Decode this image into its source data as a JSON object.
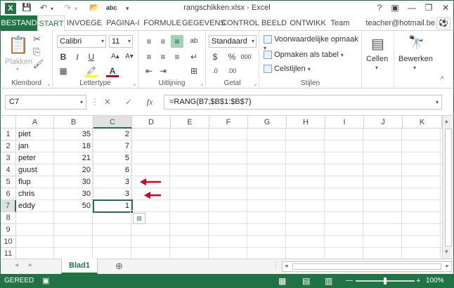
{
  "window": {
    "title": "rangschikken.xlsx - Excel",
    "help": "?",
    "ribbon_display": "▣",
    "minimize": "—",
    "restore": "❐",
    "close": "✕"
  },
  "quick_access": {
    "excel_logo": "X",
    "save": "💾",
    "undo": "↶",
    "undo_dd": "▾",
    "redo": "↷",
    "redo_dd": "▾",
    "new_file": "📂",
    "spelling": "abc",
    "customize": "▾"
  },
  "tabs": [
    {
      "label": "BESTAND"
    },
    {
      "label": "START"
    },
    {
      "label": "INVOEGE"
    },
    {
      "label": "PAGINA-I"
    },
    {
      "label": "FORMULE"
    },
    {
      "label": "GEGEVENS"
    },
    {
      "label": "CONTROL"
    },
    {
      "label": "BEELD"
    },
    {
      "label": "ONTWIKK"
    },
    {
      "label": "Team"
    }
  ],
  "user": {
    "email": "teacher@hotmail.be",
    "avatar": "⚽"
  },
  "ribbon": {
    "clipboard": {
      "label": "Klembord",
      "paste": "Plakken",
      "paste_dd": "▾",
      "paste_icon": "📋",
      "cut": "✂",
      "copy": "⎘",
      "format_painter": "🖌",
      "launcher": "⌟"
    },
    "font": {
      "label": "Lettertype",
      "name": "Calibri",
      "size": "11",
      "dd": "▾",
      "grow": "A▴",
      "shrink": "A▾",
      "bold": "B",
      "italic": "I",
      "underline": "U",
      "borders": "▦",
      "fill": "🖍",
      "font_color": "A",
      "launcher": "⌟"
    },
    "alignment": {
      "label": "Uitlijning",
      "top": "≡",
      "middle": "≡",
      "bottom": "≡",
      "left": "≡",
      "center": "≡",
      "right": "≡",
      "decrease_indent": "⇤",
      "increase_indent": "⇥",
      "orientation": "ab",
      "wrap": "↵",
      "merge": "⊞",
      "launcher": "⌟"
    },
    "number": {
      "label": "Getal",
      "format": "Standaard",
      "dd": "▾",
      "currency": "$",
      "percent": "%",
      "thousands": "000",
      "inc_decimal": ".0",
      "dec_decimal": ".00",
      "launcher": "⌟"
    },
    "styles": {
      "label": "Stijlen",
      "conditional": "Voorwaardelijke opmaak",
      "table": "Opmaken als tabel",
      "cell_styles": "Celstijlen",
      "dd": "▾"
    },
    "cells": {
      "label": "Cellen",
      "icon": "▤",
      "dd": "▾"
    },
    "editing": {
      "label": "Bewerken",
      "icon": "🔭",
      "dd": "▾"
    },
    "collapse": "^"
  },
  "formula_bar": {
    "name_box": "C7",
    "dd": "▾",
    "more": "⋮",
    "cancel": "✕",
    "enter": "✓",
    "fx": "fx",
    "formula": "=RANG(B7;$B$1:$B$7)"
  },
  "grid": {
    "columns": [
      "A",
      "B",
      "C",
      "D",
      "E",
      "F",
      "G",
      "H",
      "I",
      "J",
      "K"
    ],
    "rows": [
      "1",
      "2",
      "3",
      "4",
      "5",
      "6",
      "7",
      "8",
      "9",
      "10",
      "11"
    ],
    "data": [
      {
        "name": "piet",
        "score": "35",
        "rank": "2"
      },
      {
        "name": "jan",
        "score": "18",
        "rank": "7"
      },
      {
        "name": "peter",
        "score": "21",
        "rank": "5"
      },
      {
        "name": "guust",
        "score": "20",
        "rank": "6"
      },
      {
        "name": "flup",
        "score": "30",
        "rank": "3"
      },
      {
        "name": "chris",
        "score": "30",
        "rank": "3"
      },
      {
        "name": "eddy",
        "score": "50",
        "rank": "1"
      }
    ],
    "selected_cell": "C7",
    "quick_analysis": "⊞",
    "arrow_color": "#d0021b"
  },
  "scroll": {
    "up": "▴",
    "down": "▾",
    "left": "◂",
    "right": "▸"
  },
  "sheets": {
    "first": "◂",
    "last": "▸",
    "active": "Blad1",
    "add": "⊕"
  },
  "status": {
    "ready": "GEREED",
    "record_icon": "▣",
    "view_normal": "▦",
    "view_layout": "▤",
    "view_pagebreak": "▥",
    "zoom_out": "—",
    "zoom_in": "+",
    "zoom": "100%"
  },
  "colors": {
    "accent": "#217346",
    "selection_fill": "#e1e1e1",
    "arrow": "#d0021b"
  }
}
